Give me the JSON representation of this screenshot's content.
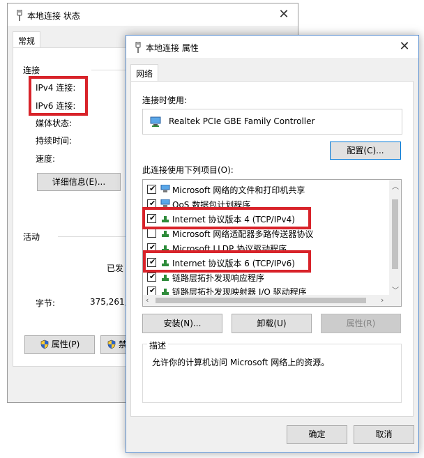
{
  "status_window": {
    "title": "本地连接 状态",
    "tab": "常规",
    "connection_header": "连接",
    "ipv4_label": "IPv4 连接:",
    "ipv6_label": "IPv6 连接:",
    "media_state_label": "媒体状态:",
    "duration_label": "持续时间:",
    "speed_label": "速度:",
    "details_button": "详细信息(E)...",
    "activity_header": "活动",
    "sent_label": "已发",
    "bytes_label": "字节:",
    "bytes_value": "375,261,",
    "properties_button": "属性(P)",
    "disable_button_partial": "禁"
  },
  "properties_window": {
    "title": "本地连接 属性",
    "tab": "网络",
    "connect_using_label": "连接时使用:",
    "adapter_name": "Realtek PCIe GBE Family Controller",
    "configure_button": "配置(C)...",
    "items_label": "此连接使用下列项目(O):",
    "items": [
      {
        "label": "Microsoft 网络的文件和打印机共享",
        "checked": true,
        "icon": "network-share-icon"
      },
      {
        "label": "QoS 数据包计划程序",
        "checked": true,
        "icon": "network-service-icon"
      },
      {
        "label": "Internet 协议版本 4 (TCP/IPv4)",
        "checked": true,
        "icon": "protocol-icon"
      },
      {
        "label": "Microsoft 网络适配器多路传送器协议",
        "checked": false,
        "icon": "protocol-icon"
      },
      {
        "label": "Microsoft LLDP 协议驱动程序",
        "checked": true,
        "icon": "protocol-icon"
      },
      {
        "label": "Internet 协议版本 6 (TCP/IPv6)",
        "checked": true,
        "icon": "protocol-icon"
      },
      {
        "label": "链路层拓扑发现响应程序",
        "checked": true,
        "icon": "protocol-icon"
      },
      {
        "label": "链路层拓扑发现映射器 I/O 驱动程序",
        "checked": true,
        "icon": "protocol-icon"
      }
    ],
    "install_button": "安装(N)...",
    "uninstall_button": "卸载(U)",
    "properties_button": "属性(R)",
    "description_header": "描述",
    "description_text": "允许你的计算机访问 Microsoft 网络上的资源。",
    "ok_button": "确定",
    "cancel_button": "取消"
  },
  "colors": {
    "highlight_red": "#d8232a",
    "focus_blue": "#0078d7",
    "protocol_green": "#2e8b3a"
  }
}
